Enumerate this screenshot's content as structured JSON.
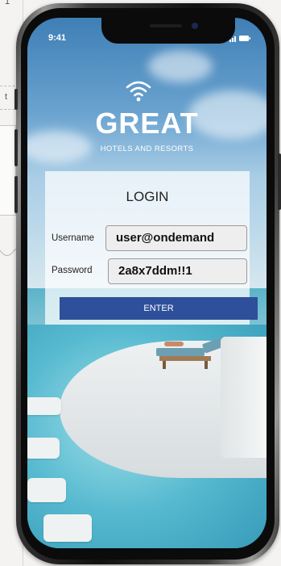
{
  "background_doc": {
    "corner_char_top": "1",
    "corner_char_mid": "t"
  },
  "status_bar": {
    "time": "9:41",
    "icons": [
      "signal-icon",
      "battery-icon"
    ]
  },
  "brand": {
    "logo_icon": "wifi-icon",
    "title": "GREAT",
    "subtitle": "HOTELS AND RESORTS"
  },
  "login": {
    "title": "LOGIN",
    "username_label": "Username",
    "username_value": "user@ondemand",
    "password_label": "Password",
    "password_value": "2a8x7ddm!!1",
    "enter_label": "ENTER"
  },
  "colors": {
    "enter_button": "#2e4f9a",
    "panel": "#ffffff"
  }
}
